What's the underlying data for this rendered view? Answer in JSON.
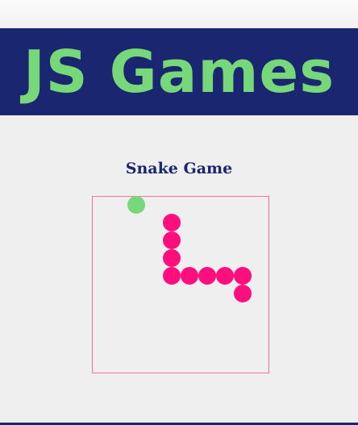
{
  "header": {
    "title": "JS Games"
  },
  "game": {
    "title": "Snake Game",
    "colors": {
      "snake": "#ff0f7b",
      "food": "#77d879",
      "board_border": "#ff6f9e",
      "header_bg": "#1b2670",
      "title_text": "#77d879"
    },
    "grid": {
      "columns": 10,
      "rows": 10
    },
    "food": {
      "col": 2,
      "row": 0
    },
    "snake": [
      {
        "col": 4,
        "row": 1
      },
      {
        "col": 4,
        "row": 2
      },
      {
        "col": 4,
        "row": 3
      },
      {
        "col": 4,
        "row": 4
      },
      {
        "col": 5,
        "row": 4
      },
      {
        "col": 6,
        "row": 4
      },
      {
        "col": 7,
        "row": 4
      },
      {
        "col": 8,
        "row": 4
      },
      {
        "col": 8,
        "row": 5
      }
    ]
  }
}
